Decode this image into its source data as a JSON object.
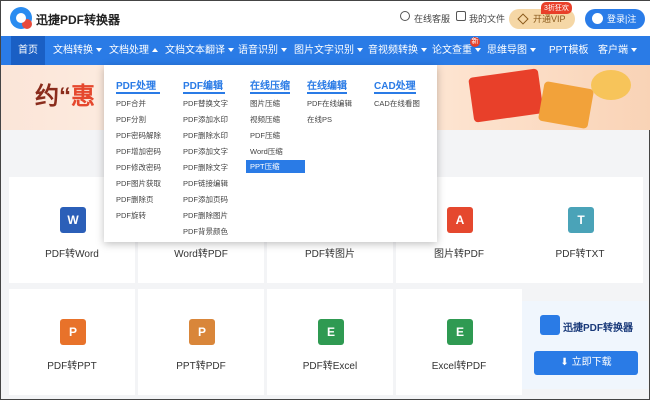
{
  "header": {
    "app_name": "迅捷PDF转换器",
    "service_label": "在线客服",
    "files_label": "我的文件",
    "vip_label": "开通VIP",
    "vip_badge": "3折狂欢",
    "login_label": "登录|注册"
  },
  "nav": {
    "items": [
      {
        "label": "首页"
      },
      {
        "label": "文档转换"
      },
      {
        "label": "文档处理"
      },
      {
        "label": "文档文本翻译"
      },
      {
        "label": "语音识别"
      },
      {
        "label": "图片文字识别"
      },
      {
        "label": "音视频转换"
      },
      {
        "label": "论文查重"
      },
      {
        "label": "思维导图"
      },
      {
        "label": "PPT模板"
      },
      {
        "label": "客户端"
      }
    ],
    "new_badge": "新"
  },
  "banner": {
    "text_prefix": "约“",
    "text_highlight": "惠"
  },
  "dropdown": {
    "columns": [
      {
        "title": "PDF处理",
        "items": [
          "PDF合并",
          "PDF分割",
          "PDF密码解除",
          "PDF增加密码",
          "PDF修改密码",
          "PDF图片获取",
          "PDF删除页",
          "PDF旋转"
        ]
      },
      {
        "title": "PDF编辑",
        "items": [
          "PDF替换文字",
          "PDF添加水印",
          "PDF删除水印",
          "PDF添加文字",
          "PDF删除文字",
          "PDF链接编辑",
          "PDF添加页码",
          "PDF删除图片",
          "PDF背景颜色"
        ]
      },
      {
        "title": "在线压缩",
        "items": [
          "图片压缩",
          "视频压缩",
          "PDF压缩",
          "Word压缩",
          "PPT压缩"
        ]
      },
      {
        "title": "在线编辑",
        "items": [
          "PDF在线编辑",
          "在线PS"
        ]
      },
      {
        "title": "CAD处理",
        "items": [
          "CAD在线看图"
        ]
      }
    ]
  },
  "cards": [
    {
      "label": "PDF转Word",
      "icon": "W",
      "color": "#2b5fb8"
    },
    {
      "label": "Word转PDF",
      "icon": "W",
      "color": "#2b5fb8"
    },
    {
      "label": "PDF转图片",
      "icon": "▲",
      "color": "#e5482e"
    },
    {
      "label": "图片转PDF",
      "icon": "A",
      "color": "#e5482e"
    },
    {
      "label": "PDF转TXT",
      "icon": "T",
      "color": "#4aa3b8"
    },
    {
      "label": "PDF转PPT",
      "icon": "P",
      "color": "#e8722a"
    },
    {
      "label": "PPT转PDF",
      "icon": "P",
      "color": "#d9863a"
    },
    {
      "label": "PDF转Excel",
      "icon": "E",
      "color": "#2f9a52"
    },
    {
      "label": "Excel转PDF",
      "icon": "E",
      "color": "#2f9a52"
    }
  ],
  "promo": {
    "app_name": "迅捷PDF转换器",
    "download_label": "立即下载"
  }
}
